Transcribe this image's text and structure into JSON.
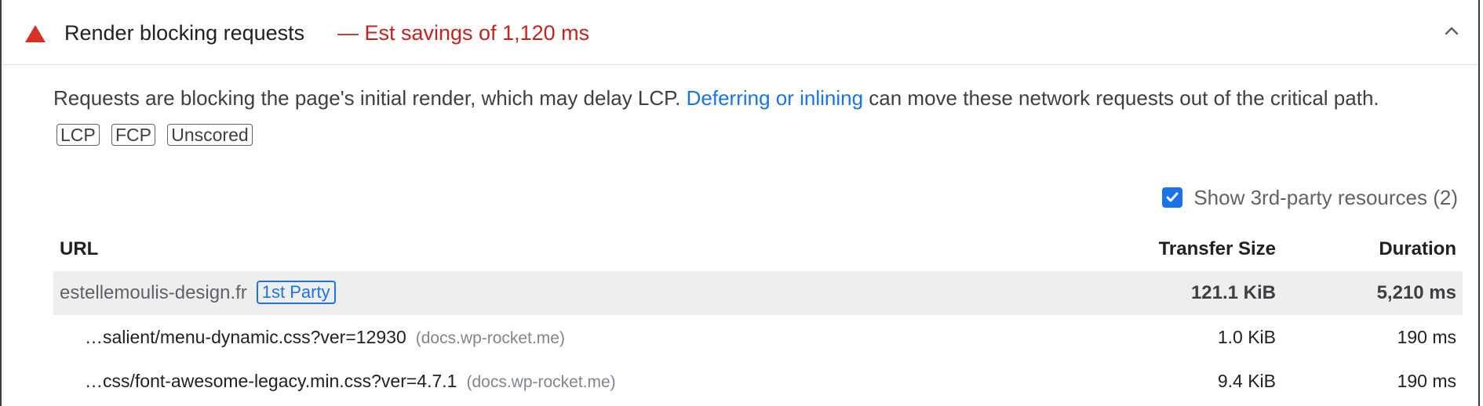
{
  "audit": {
    "title": "Render blocking requests",
    "savings": "— Est savings of 1,120 ms",
    "status_color": "#d93025"
  },
  "description": {
    "text_before": "Requests are blocking the page's initial render, which may delay LCP. ",
    "link_text": "Deferring or inlining",
    "text_after": " can move these network requests out of the critical path.",
    "tags": [
      "LCP",
      "FCP",
      "Unscored"
    ]
  },
  "third_party": {
    "label": "Show 3rd-party resources (2)",
    "checked": true
  },
  "table": {
    "columns": [
      "URL",
      "Transfer Size",
      "Duration"
    ],
    "group": {
      "url": "estellemoulis-design.fr",
      "badge": "1st Party",
      "size": "121.1 KiB",
      "duration": "5,210 ms"
    },
    "rows": [
      {
        "url": "…salient/menu-dynamic.css?ver=12930",
        "domain": "(docs.wp-rocket.me)",
        "size": "1.0 KiB",
        "duration": "190 ms"
      },
      {
        "url": "…css/font-awesome-legacy.min.css?ver=4.7.1",
        "domain": "(docs.wp-rocket.me)",
        "size": "9.4 KiB",
        "duration": "190 ms"
      }
    ]
  }
}
